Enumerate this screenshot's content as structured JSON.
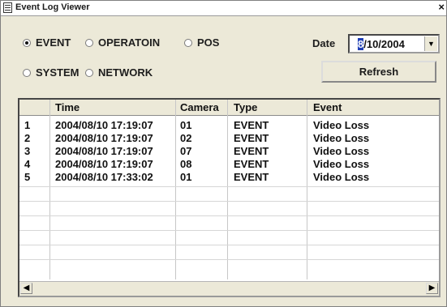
{
  "window": {
    "title": "Event Log Viewer",
    "close_glyph": "×"
  },
  "filters": [
    {
      "label": "EVENT",
      "checked": true
    },
    {
      "label": "OPERATOIN",
      "checked": false
    },
    {
      "label": "POS",
      "checked": false
    },
    {
      "label": "SYSTEM",
      "checked": false
    },
    {
      "label": "NETWORK",
      "checked": false
    }
  ],
  "date": {
    "label": "Date",
    "value_selected": "8",
    "value_rest": "/10/2004"
  },
  "refresh_label": "Refresh",
  "table": {
    "columns": [
      "",
      "Time",
      "Camera",
      "Type",
      "Event"
    ],
    "rows": [
      [
        "1",
        "2004/08/10 17:19:07",
        "01",
        "EVENT",
        "Video Loss"
      ],
      [
        "2",
        "2004/08/10 17:19:07",
        "02",
        "EVENT",
        "Video Loss"
      ],
      [
        "3",
        "2004/08/10 17:19:07",
        "07",
        "EVENT",
        "Video Loss"
      ],
      [
        "4",
        "2004/08/10 17:19:07",
        "08",
        "EVENT",
        "Video Loss"
      ],
      [
        "5",
        "2004/08/10 17:33:02",
        "01",
        "EVENT",
        "Video Loss"
      ]
    ]
  },
  "icons": {
    "dropdown": "chevron-down-icon",
    "scroll_left": "arrow-left-icon",
    "scroll_right": "arrow-right-icon"
  }
}
